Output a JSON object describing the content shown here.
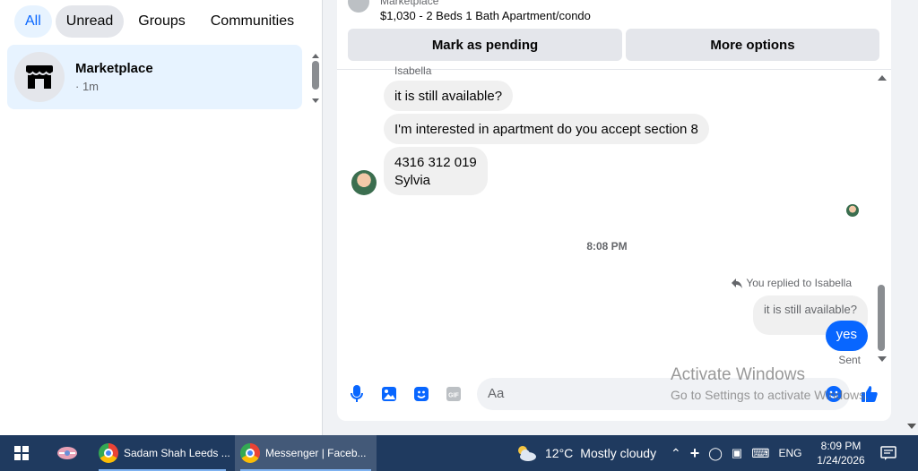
{
  "filters": [
    "All",
    "Unread",
    "Groups",
    "Communities"
  ],
  "conversation": {
    "name": "Marketplace",
    "time": "· 1m"
  },
  "listing": {
    "source": "Marketplace",
    "title": "$1,030 - 2 Beds 1 Bath Apartment/condo"
  },
  "actions": {
    "pending": "Mark as pending",
    "more": "More options"
  },
  "thread": {
    "sender_cut": "Isabella",
    "messages": [
      "it is still available?",
      "I'm interested in apartment do you accept section 8"
    ],
    "last_line1": "4316 312 019",
    "last_line2": "Sylvia",
    "timestamp": "8:08 PM",
    "replied_label": "You replied to Isabella",
    "quoted": "it is still available?",
    "reply": "yes",
    "status": "Sent"
  },
  "composer": {
    "placeholder": "Aa"
  },
  "watermark": {
    "line1": "Activate Windows",
    "line2": "Go to Settings to activate Windows."
  },
  "taskbar": {
    "apps": [
      "Sadam Shah Leeds ...",
      "Messenger | Faceb..."
    ],
    "weather_temp": "12°C",
    "weather_text": "Mostly cloudy",
    "lang": "ENG",
    "time": "8:09 PM",
    "date": "1/24/2026"
  },
  "colors": {
    "accent": "#0866ff",
    "selected_bg": "#e7f3ff",
    "bubble_bg": "#f0f0f0"
  }
}
